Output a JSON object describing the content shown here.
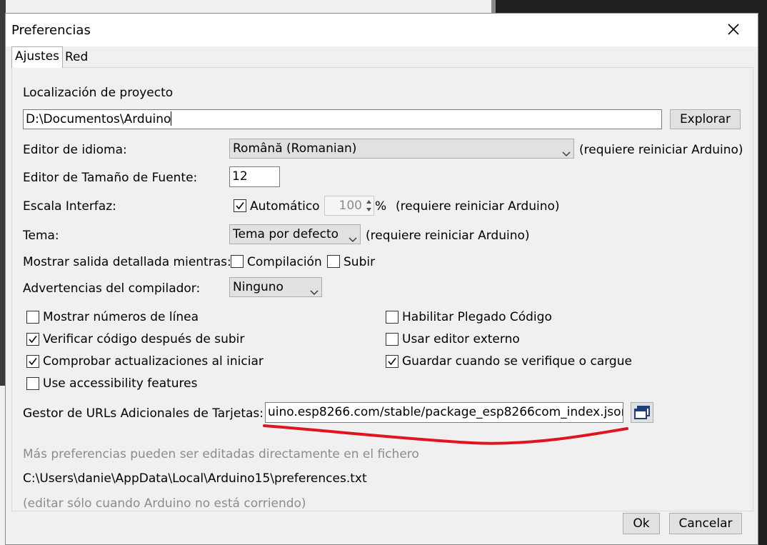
{
  "window": {
    "title": "Preferencias"
  },
  "tabs": [
    {
      "label": "Ajustes"
    },
    {
      "label": "Red"
    }
  ],
  "project": {
    "label": "Localización de proyecto",
    "path": "D:\\Documentos\\Arduino",
    "browse_label": "Explorar"
  },
  "language": {
    "label": "Editor de idioma:",
    "selected": "Română (Romanian)",
    "note": "(requiere reiniciar Arduino)"
  },
  "font_size": {
    "label": "Editor de Tamaño de Fuente:",
    "value": "12"
  },
  "scale": {
    "label": "Escala Interfaz:",
    "auto_label": "Automático",
    "value": "100",
    "unit": "%",
    "note": "(requiere reiniciar Arduino)"
  },
  "theme": {
    "label": "Tema:",
    "selected": "Tema por defecto",
    "note": "(requiere reiniciar Arduino)"
  },
  "verbose": {
    "label": "Mostrar salida detallada mientras:",
    "compile_label": "Compilación",
    "upload_label": "Subir"
  },
  "warnings": {
    "label": "Advertencias del compilador:",
    "selected": "Ninguno"
  },
  "options": {
    "show_line_numbers": "Mostrar números de línea",
    "verify_after_upload": "Verificar código después de subir",
    "check_updates": "Comprobar actualizaciones al iniciar",
    "accessibility": "Use accessibility features",
    "code_folding": "Habilitar Plegado Código",
    "external_editor": "Usar editor externo",
    "save_on_verify": "Guardar cuando se verifique o cargue"
  },
  "board_urls": {
    "label": "Gestor de URLs Adicionales de Tarjetas:",
    "value": "uino.esp8266.com/stable/package_esp8266com_index.json"
  },
  "info": {
    "more_prefs": "Más preferencias pueden ser editadas directamente en el fichero",
    "file_path": "C:\\Users\\danie\\AppData\\Local\\Arduino15\\preferences.txt",
    "edit_note": "(editar sólo cuando Arduino no está corriendo)"
  },
  "footer": {
    "ok_label": "Ok",
    "cancel_label": "Cancelar"
  },
  "colors": {
    "annotation": "#e0141e",
    "window_bg": "#f0f0f0",
    "dark_bg": "#202020"
  }
}
